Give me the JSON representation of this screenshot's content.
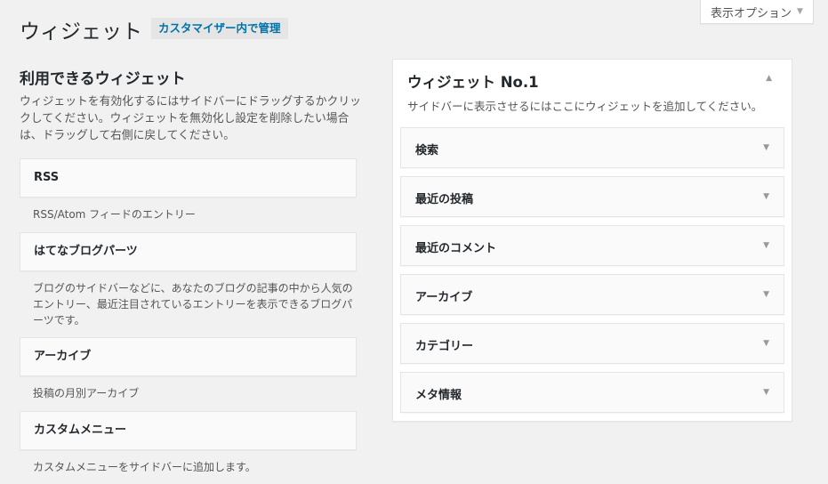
{
  "header": {
    "screen_options": "表示オプション",
    "title": "ウィジェット",
    "manage_button": "カスタマイザー内で管理"
  },
  "available": {
    "title": "利用できるウィジェット",
    "description": "ウィジェットを有効化するにはサイドバーにドラッグするかクリックしてください。ウィジェットを無効化し設定を削除したい場合は、ドラッグして右側に戻してください。",
    "widgets": [
      {
        "name": "RSS",
        "desc": "RSS/Atom フィードのエントリー"
      },
      {
        "name": "はてなブログパーツ",
        "desc": "ブログのサイドバーなどに、あなたのブログの記事の中から人気のエントリー、最近注目されているエントリーを表示できるブログパーツです。"
      },
      {
        "name": "アーカイブ",
        "desc": "投稿の月別アーカイブ"
      },
      {
        "name": "カスタムメニュー",
        "desc": "カスタムメニューをサイドバーに追加します。"
      }
    ]
  },
  "sidebar": {
    "title": "ウィジェット No.1",
    "description": "サイドバーに表示させるにはここにウィジェットを追加してください。",
    "widgets": [
      "検索",
      "最近の投稿",
      "最近のコメント",
      "アーカイブ",
      "カテゴリー",
      "メタ情報"
    ]
  }
}
